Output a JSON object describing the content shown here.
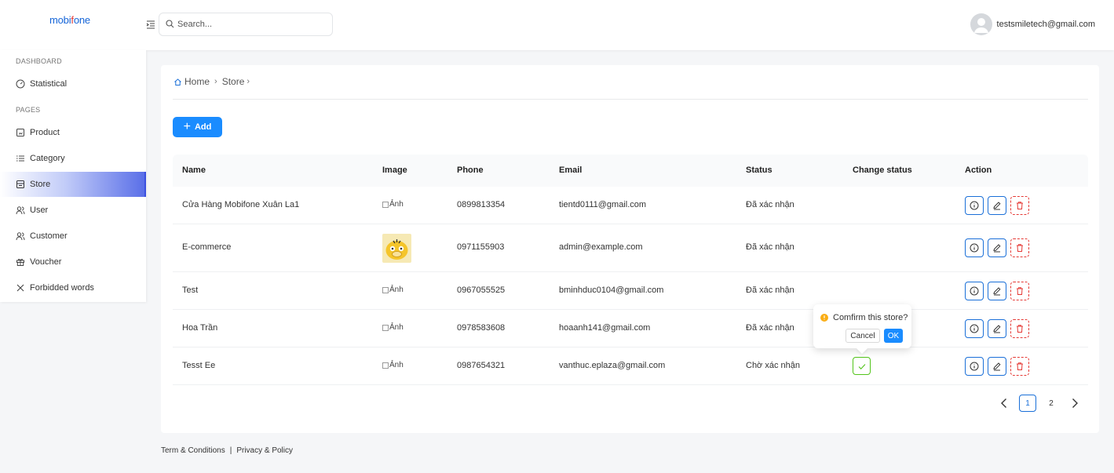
{
  "header": {
    "logo_main": "mobi",
    "logo_accent": "f",
    "logo_rest": "one",
    "search_placeholder": "Search...",
    "user_email": "testsmiletech@gmail.com"
  },
  "sidebar": {
    "sections": [
      {
        "label": "DASHBOARD"
      },
      {
        "label": "PAGES"
      }
    ],
    "items": [
      {
        "label": "Statistical",
        "icon": "dashboard-icon"
      },
      {
        "label": "Product",
        "icon": "product-icon"
      },
      {
        "label": "Category",
        "icon": "list-icon"
      },
      {
        "label": "Store",
        "icon": "store-icon",
        "active": true
      },
      {
        "label": "User",
        "icon": "user-icon"
      },
      {
        "label": "Customer",
        "icon": "user-icon"
      },
      {
        "label": "Voucher",
        "icon": "gift-icon"
      },
      {
        "label": "Forbidded words",
        "icon": "close-icon"
      }
    ]
  },
  "breadcrumb": {
    "home": "Home",
    "current": "Store"
  },
  "toolbar": {
    "add_label": "Add"
  },
  "table": {
    "columns": [
      "Name",
      "Image",
      "Phone",
      "Email",
      "Status",
      "Change status",
      "Action"
    ],
    "rows": [
      {
        "name": "Cửa Hàng Mobifone Xuân La1",
        "image": "Ảnh",
        "phone": "0899813354",
        "email": "tientd0111@gmail.com",
        "status": "Đã xác nhận"
      },
      {
        "name": "E-commerce",
        "image": "",
        "phone": "0971155903",
        "email": "admin@example.com",
        "status": "Đã xác nhận"
      },
      {
        "name": "Test",
        "image": "Ảnh",
        "phone": "0967055525",
        "email": "bminhduc0104@gmail.com",
        "status": "Đã xác nhận"
      },
      {
        "name": "Hoa Trần",
        "image": "Ảnh",
        "phone": "0978583608",
        "email": "hoaanh141@gmail.com",
        "status": "Đã xác nhận"
      },
      {
        "name": "Tesst Ee",
        "image": "Ảnh",
        "phone": "0987654321",
        "email": "vanthuc.eplaza@gmail.com",
        "status": "Chờ xác nhận"
      }
    ]
  },
  "popconfirm": {
    "message": "Comfirm this store?",
    "cancel_label": "Cancel",
    "ok_label": "OK"
  },
  "pagination": {
    "pages": [
      "1",
      "2"
    ],
    "current": "1"
  },
  "footer": {
    "terms": "Term & Conditions",
    "separator": "|",
    "privacy": "Privacy & Policy"
  },
  "colors": {
    "primary": "#1a8cff",
    "danger": "#e53935",
    "success": "#52c41a",
    "warning": "#faad14"
  }
}
